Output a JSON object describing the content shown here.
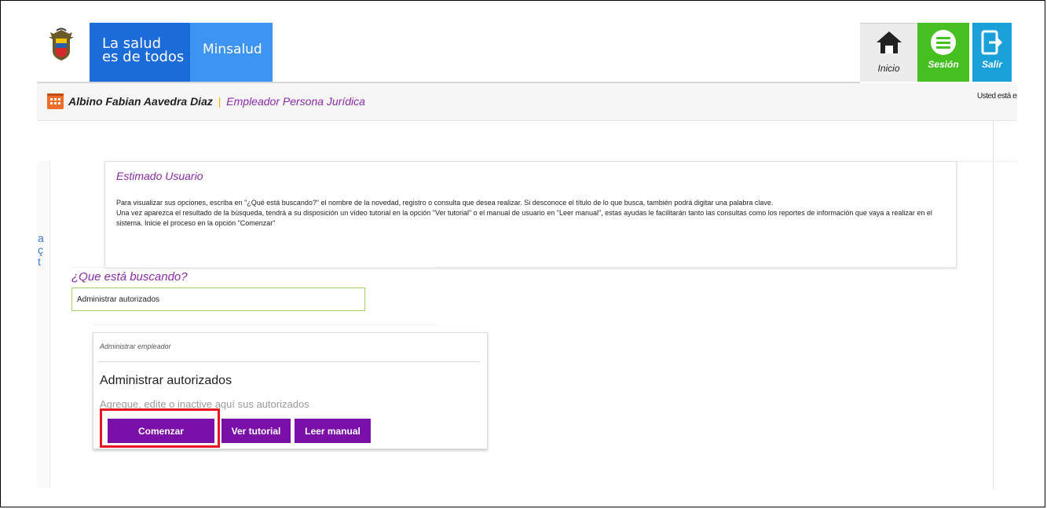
{
  "header": {
    "brand_line1": "La salud",
    "brand_line2": "es de todos",
    "brand_name": "Minsalud",
    "nav": {
      "inicio": "Inicio",
      "sesion": "Sesión",
      "salir": "Salir"
    }
  },
  "user": {
    "name": "Albino Fabian Aavedra Diaz",
    "separator": "|",
    "role": "Empleador Persona Jurídica",
    "location_prefix": "Usted está en"
  },
  "info_panel": {
    "title": "Estimado Usuario",
    "paragraph1": "Para visualizar sus opciones, escriba en \"¿Qué está buscando?\" el nombre de la novedad, registro o consulta que desea realizar. Si desconoce el título de lo que busca, también podrá digitar una palabra clave.",
    "paragraph2": "Una vez aparezca el resultado de la búsqueda, tendrá a su disposición un vídeo tutorial en la opción \"Ver tutorial\" o el manual de usuario en \"Leer manual\", estas ayudas le facilitarán tanto las consultas como los reportes de información que vaya a realizar en el sistema. Inicie el proceso en la opción \"Comenzar\""
  },
  "search": {
    "label": "¿Que está buscando?",
    "value": "Administrar autorizados"
  },
  "result_card": {
    "category": "Administrar empleador",
    "title": "Administrar autorizados",
    "description": "Agregue, edite o inactive aquí sus autorizados",
    "buttons": {
      "start": "Comenzar",
      "tutorial": "Ver tutorial",
      "manual": "Leer manual"
    }
  },
  "colors": {
    "brand_blue": "#1b6bd9",
    "brand_light_blue": "#3d95f1",
    "accent_purple": "#7a10a8",
    "session_green": "#46c021",
    "exit_blue": "#1aa0d8",
    "highlight_red": "#e8141f"
  },
  "icons": [
    "coat-of-arms-icon",
    "home-icon",
    "menu-icon",
    "exit-icon",
    "calendar-icon"
  ]
}
